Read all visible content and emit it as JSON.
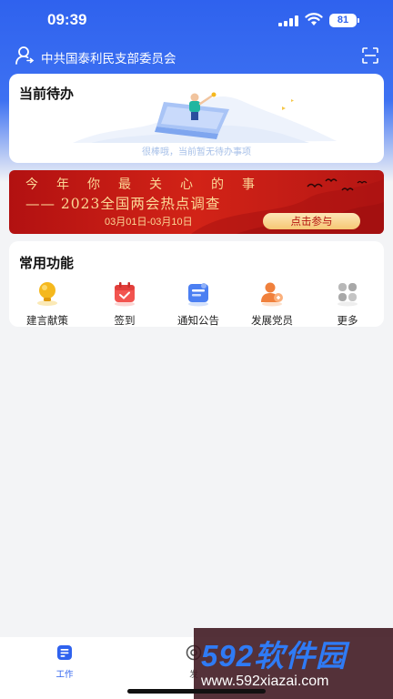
{
  "status_bar": {
    "time": "09:39",
    "battery": "81"
  },
  "org": {
    "name": "中共国泰利民支部委员会"
  },
  "todo": {
    "title": "当前待办",
    "empty_text": "很棒哦，当前暂无待办事项"
  },
  "banner": {
    "line1": "今年你最关心的事",
    "line2": "—— 2023全国两会热点调查",
    "dates": "03月01日-03月10日",
    "button": "点击参与"
  },
  "functions": {
    "title": "常用功能",
    "items": [
      {
        "label": "建言献策",
        "icon": "lightbulb-icon",
        "color": "#f5b81d"
      },
      {
        "label": "签到",
        "icon": "calendar-icon",
        "color": "#f2544f"
      },
      {
        "label": "通知公告",
        "icon": "announcement-icon",
        "color": "#4b7ff2"
      },
      {
        "label": "发展党员",
        "icon": "member-icon",
        "color": "#f0803c"
      },
      {
        "label": "更多",
        "icon": "grid-icon",
        "color": "#b8b8b8"
      }
    ]
  },
  "tabs": [
    {
      "label": "工作",
      "icon": "work-icon",
      "active": true
    },
    {
      "label": "发",
      "icon": "at-icon",
      "active": false
    }
  ],
  "watermark": {
    "brand": "592软件园",
    "url": "www.592xiazai.com"
  },
  "colors": {
    "primary": "#2f62ee",
    "banner_red": "#c81d15",
    "banner_gold": "#fbd796"
  }
}
